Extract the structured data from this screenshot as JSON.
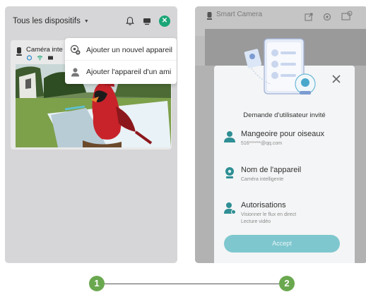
{
  "left": {
    "device_filter": "Tous les dispositifs",
    "camera_name": "Caméra inte",
    "menu": [
      {
        "label": "Ajouter un nouvel appareil",
        "icon": "add-device-icon"
      },
      {
        "label": "Ajouter l'appareil d'un ami",
        "icon": "friend-icon"
      }
    ]
  },
  "right": {
    "bg_camera_name": "Smart Camera",
    "modal": {
      "title": "Demande d'utilisateur invité",
      "fields": [
        {
          "label": "Mangeoire pour oiseaux",
          "sub": "516******@qq.com",
          "icon": "user-icon"
        },
        {
          "label": "Nom de l'appareil",
          "sub": "Caméra intelligente",
          "icon": "device-icon"
        },
        {
          "label": "Autorisations",
          "sub": "Visionner le flux en direct",
          "sub2": "Lecture vidéo",
          "icon": "permission-icon"
        }
      ],
      "accept_label": "Accept"
    }
  },
  "steps": [
    "1",
    "2"
  ],
  "colors": {
    "accent": "#1aa576",
    "teal": "#7fc7cf",
    "step": "#6aa84f"
  }
}
